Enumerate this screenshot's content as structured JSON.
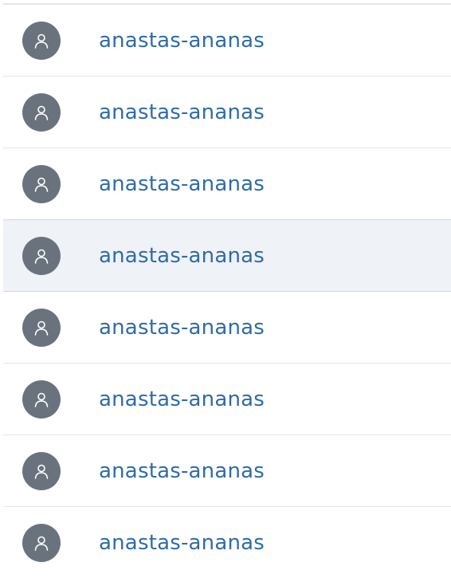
{
  "users": [
    {
      "name": "anastas-ananas",
      "avatar_icon": "person-icon"
    },
    {
      "name": "anastas-ananas",
      "avatar_icon": "person-icon"
    },
    {
      "name": "anastas-ananas",
      "avatar_icon": "person-icon"
    },
    {
      "name": "anastas-ananas",
      "avatar_icon": "person-icon",
      "hovered": true
    },
    {
      "name": "anastas-ananas",
      "avatar_icon": "person-icon"
    },
    {
      "name": "anastas-ananas",
      "avatar_icon": "person-icon"
    },
    {
      "name": "anastas-ananas",
      "avatar_icon": "person-icon"
    },
    {
      "name": "anastas-ananas",
      "avatar_icon": "person-icon"
    }
  ],
  "colors": {
    "link": "#2f6ca8",
    "avatar_bg": "#6a737d",
    "hover_bg": "#eff2f6",
    "divider": "#e3e6ea"
  }
}
